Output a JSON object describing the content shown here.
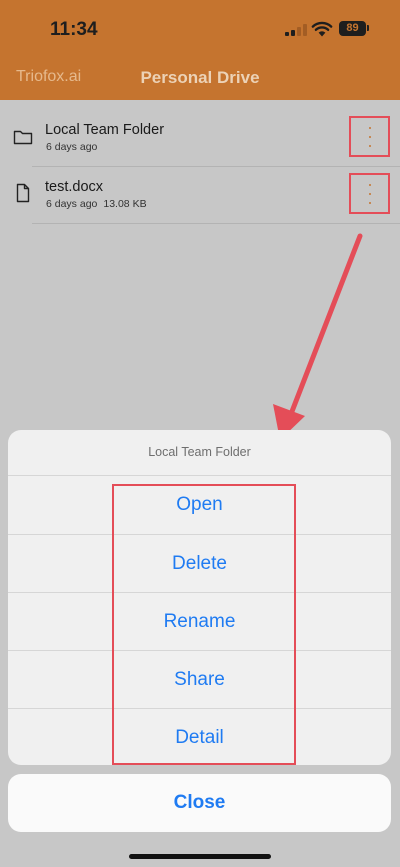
{
  "status": {
    "time": "11:34",
    "battery": "89"
  },
  "nav": {
    "back_label": "Triofox.ai",
    "title": "Personal Drive"
  },
  "files": [
    {
      "name": "Local Team Folder",
      "modified": "6 days ago",
      "size": "",
      "icon": "folder-icon"
    },
    {
      "name": "test.docx",
      "modified": "6 days ago",
      "size": "13.08 KB",
      "icon": "document-icon"
    }
  ],
  "action_sheet": {
    "title": "Local Team Folder",
    "actions": [
      "Open",
      "Delete",
      "Rename",
      "Share",
      "Detail"
    ],
    "cancel_label": "Close"
  },
  "colors": {
    "header": "#c5742f",
    "action_blue": "#1f7bf2",
    "annotation_red": "#e44d58"
  }
}
